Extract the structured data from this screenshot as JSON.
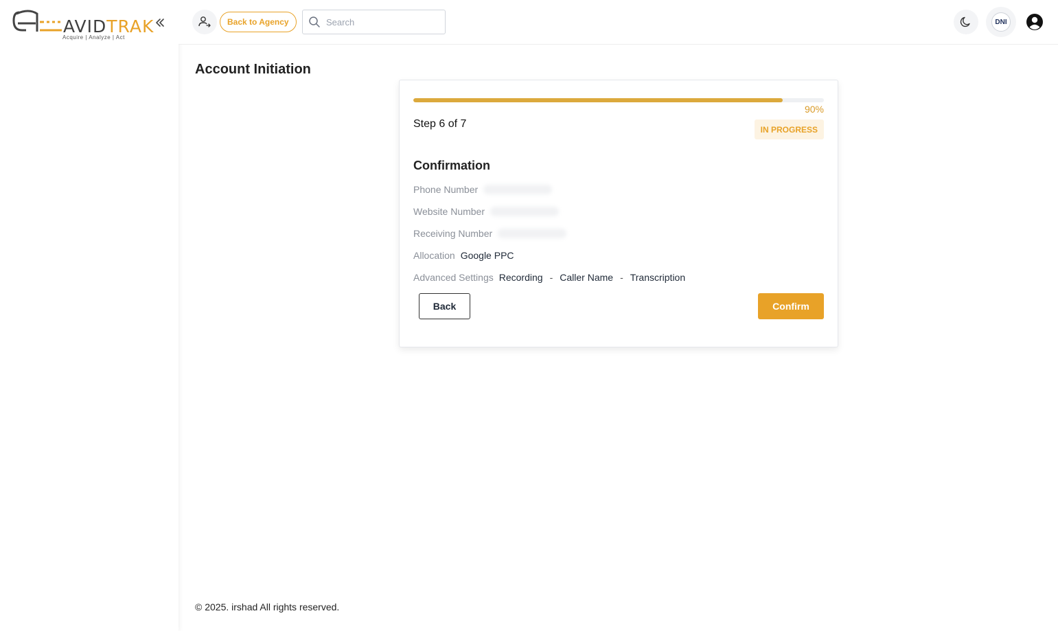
{
  "brand": {
    "name_part1": "AVID",
    "name_part2": "TRAK",
    "tagline": "Acquire  |  Analyze  |  Act"
  },
  "header": {
    "back_to_agency_label": "Back to Agency",
    "search_placeholder": "Search",
    "dni_label": "DNI"
  },
  "page": {
    "title": "Account Initiation"
  },
  "wizard": {
    "progress_percent": 90,
    "progress_label": "90%",
    "step_label": "Step 6 of 7",
    "status_badge": "IN PROGRESS",
    "section_title": "Confirmation",
    "fields": {
      "phone_number_label": "Phone Number",
      "website_number_label": "Website Number",
      "receiving_number_label": "Receiving Number",
      "allocation_label": "Allocation",
      "allocation_value": "Google PPC",
      "advanced_settings_label": "Advanced Settings",
      "advanced_settings_values": [
        "Recording",
        "Caller Name",
        "Transcription"
      ],
      "separator": "-"
    },
    "back_label": "Back",
    "confirm_label": "Confirm"
  },
  "footer": {
    "copyright": "© 2025. irshad All rights reserved."
  },
  "colors": {
    "accent": "#e8a228",
    "badge_bg": "#fdf3e2",
    "progress_fill": "#dca93c"
  },
  "icons": {
    "collapse": "chevrons-left-icon",
    "user_switch": "users-icon",
    "search": "search-icon",
    "theme": "moon-icon",
    "account": "user-circle-icon"
  }
}
